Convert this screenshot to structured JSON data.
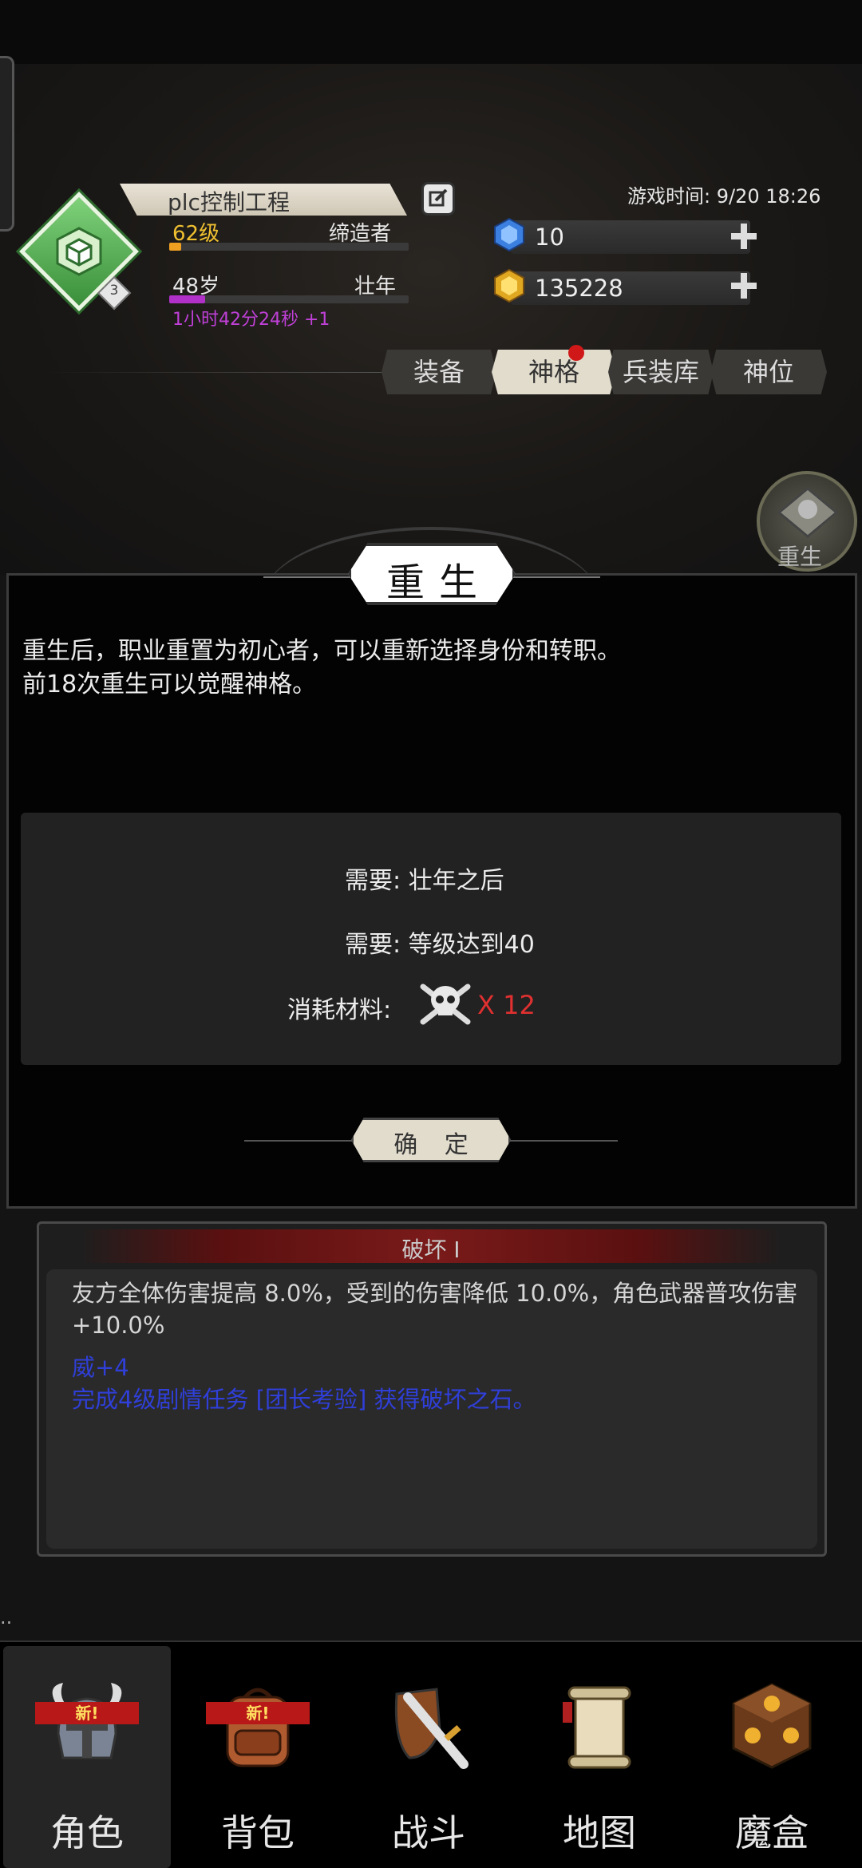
{
  "player": {
    "name": "plc控制工程",
    "level": "62级",
    "job": "缔造者",
    "age": "48岁",
    "stage": "壮年",
    "timer": "1小时42分24秒 +1",
    "rank": "3",
    "level_progress": 0.05,
    "age_progress": 0.15
  },
  "game_time": "游戏时间: 9/20 18:26",
  "currency": {
    "diamond": "10",
    "gold": "135228"
  },
  "tabs": [
    "装备",
    "神格",
    "兵装库",
    "神位"
  ],
  "side_button": "重生",
  "panel": {
    "title": "重生",
    "desc_line1": "重生后，职业重置为初心者，可以重新选择身份和转职。",
    "desc_line2": "前18次重生可以觉醒神格。",
    "req1": "需要: 壮年之后",
    "req2": "需要: 等级达到40",
    "cost_label": "消耗材料:",
    "cost_value": "X 12",
    "confirm": "确 定"
  },
  "info": {
    "header": "破坏 Ⅰ",
    "main": "友方全体伤害提高 8.0%，受到的伤害降低 10.0%，角色武器普攻伤害+10.0%",
    "line2": "威+4",
    "line3": "完成4级剧情任务 [团长考验] 获得破坏之石。"
  },
  "nav": [
    {
      "label": "角色",
      "badge": "新!",
      "icon": "helmet-icon"
    },
    {
      "label": "背包",
      "badge": "新!",
      "icon": "backpack-icon"
    },
    {
      "label": "战斗",
      "badge": "",
      "icon": "sword-shield-icon"
    },
    {
      "label": "地图",
      "badge": "",
      "icon": "scroll-map-icon"
    },
    {
      "label": "魔盒",
      "badge": "",
      "icon": "magic-box-icon"
    }
  ],
  "colors": {
    "level": "#f0c030",
    "timer": "#c040d8",
    "cost": "#e03030",
    "info_blue": "#2f3fd8"
  }
}
